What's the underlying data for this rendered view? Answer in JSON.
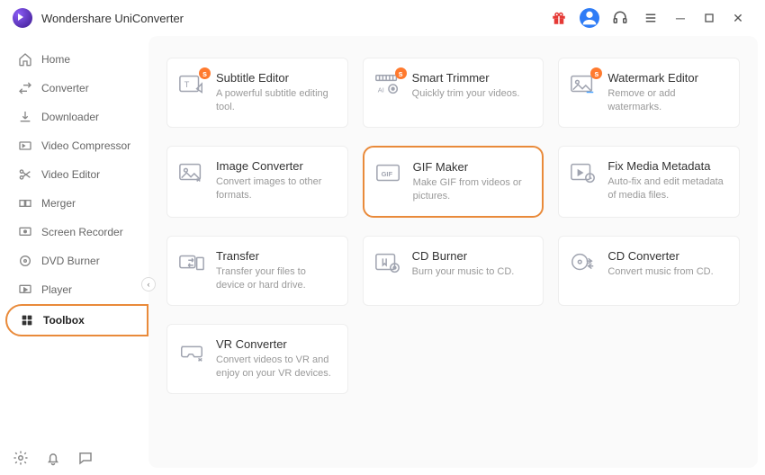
{
  "app": {
    "title": "Wondershare UniConverter"
  },
  "sidebar": {
    "items": [
      {
        "label": "Home"
      },
      {
        "label": "Converter"
      },
      {
        "label": "Downloader"
      },
      {
        "label": "Video Compressor"
      },
      {
        "label": "Video Editor"
      },
      {
        "label": "Merger"
      },
      {
        "label": "Screen Recorder"
      },
      {
        "label": "DVD Burner"
      },
      {
        "label": "Player"
      },
      {
        "label": "Toolbox"
      }
    ]
  },
  "tools": [
    {
      "title": "Subtitle Editor",
      "desc": "A powerful subtitle editing tool.",
      "badge": "s"
    },
    {
      "title": "Smart Trimmer",
      "desc": "Quickly trim your videos.",
      "badge": "s"
    },
    {
      "title": "Watermark Editor",
      "desc": "Remove or add watermarks.",
      "badge": "s"
    },
    {
      "title": "Image Converter",
      "desc": "Convert images to other formats."
    },
    {
      "title": "GIF Maker",
      "desc": "Make GIF from videos or pictures.",
      "highlight": true
    },
    {
      "title": "Fix Media Metadata",
      "desc": "Auto-fix and edit metadata of media files."
    },
    {
      "title": "Transfer",
      "desc": "Transfer your files to device or hard drive."
    },
    {
      "title": "CD Burner",
      "desc": "Burn your music to CD."
    },
    {
      "title": "CD Converter",
      "desc": "Convert music from CD."
    },
    {
      "title": "VR Converter",
      "desc": "Convert videos to VR and enjoy on your VR devices."
    }
  ]
}
